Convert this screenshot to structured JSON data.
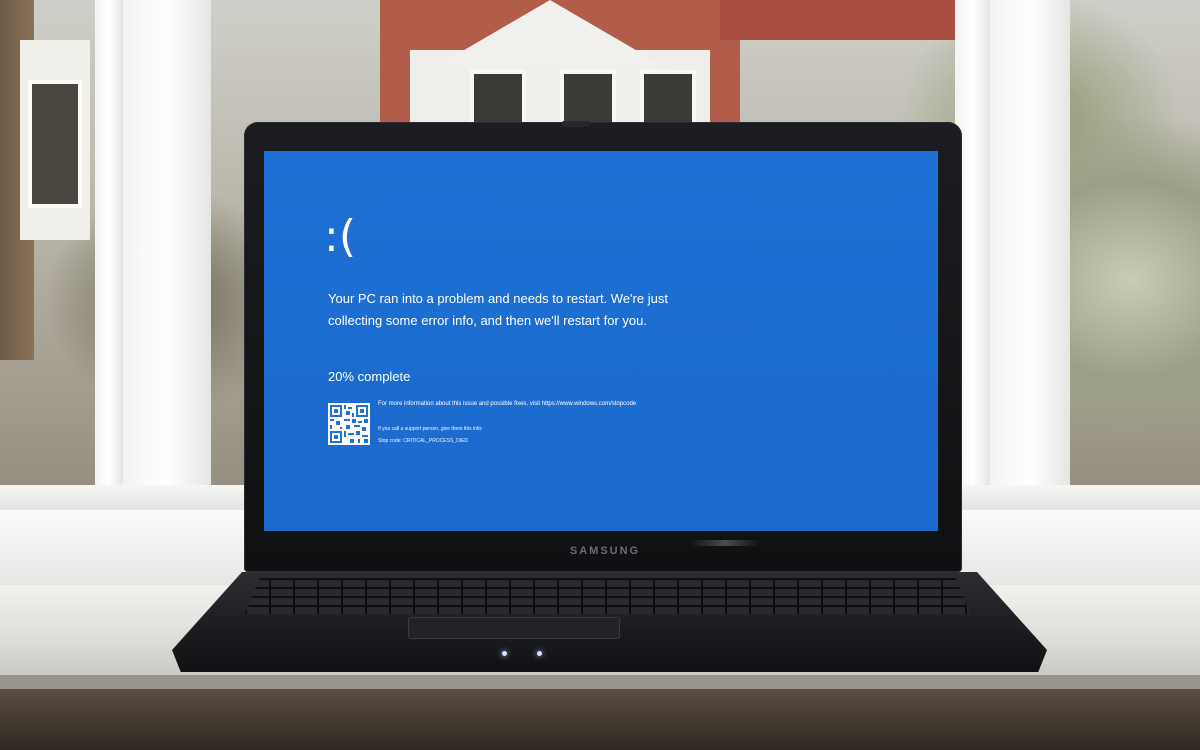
{
  "screen": {
    "emoticon": ":(",
    "message": "Your PC ran into a problem and needs to restart. We're just collecting some error info, and then we'll restart for you.",
    "progress_text": "20% complete",
    "progress_percent": 20,
    "more_info": "For more information about this issue and possible fixes, visit https://www.windows.com/stopcode",
    "support_note": "If you call a support person, give them this info:",
    "stop_code": "Stop code: CRITICAL_PROCESS_DIED",
    "background_color": "#1f72d6",
    "text_color": "#ffffff"
  },
  "laptop": {
    "brand": "SAMSUNG"
  }
}
